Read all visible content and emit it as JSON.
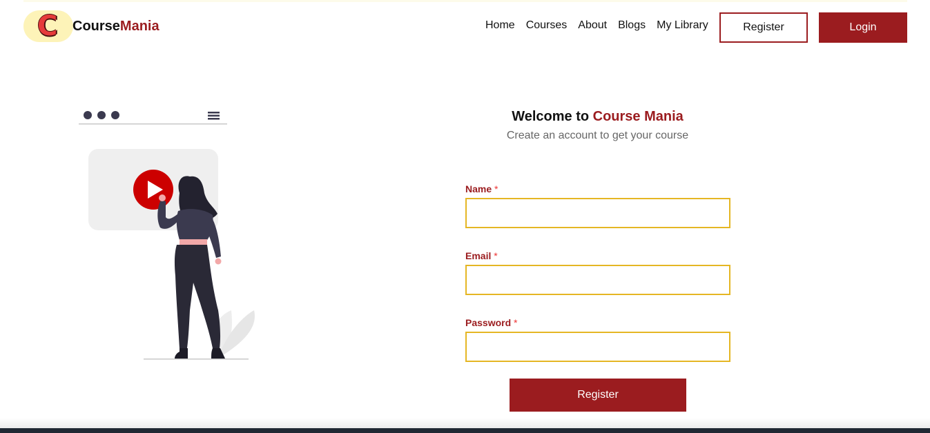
{
  "header": {
    "logo_letter": "C",
    "logo_text_primary": "Course",
    "logo_text_accent": "Mania",
    "nav": {
      "home": "Home",
      "courses": "Courses",
      "about": "About",
      "blogs": "Blogs",
      "my_library": "My Library"
    },
    "register_label": "Register",
    "login_label": "Login"
  },
  "form": {
    "title_prefix": "Welcome to",
    "title_accent": "Course Mania",
    "subtitle": "Create an account to get your course",
    "required_marker": "*",
    "name_label": "Name",
    "name_value": "",
    "email_label": "Email",
    "email_value": "",
    "password_label": "Password",
    "password_value": "",
    "submit_label": "Register"
  },
  "colors": {
    "brand": "#9b1c1f",
    "input_border": "#e5b623",
    "logo_badge": "#fdf3b8",
    "play_button": "#cc0000"
  },
  "icons": {
    "illustration": "woman-watching-video-illustration",
    "play": "play-icon",
    "menu": "hamburger-menu-icon"
  }
}
